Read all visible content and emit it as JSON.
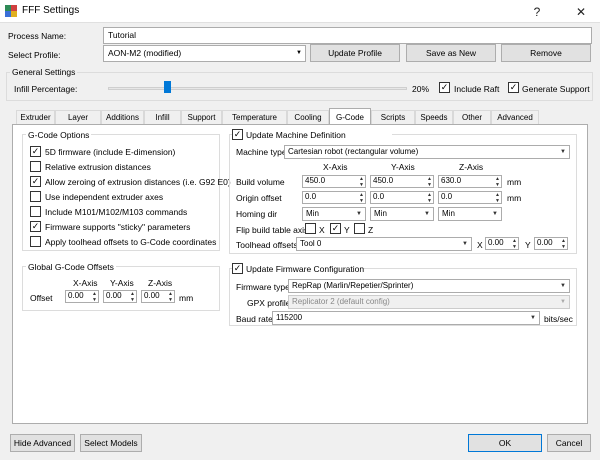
{
  "window": {
    "title": "FFF Settings",
    "help": "?",
    "close": "✕"
  },
  "process": {
    "label": "Process Name:",
    "value": "Tutorial"
  },
  "profile": {
    "label": "Select Profile:",
    "value": "AON-M2 (modified)",
    "update": "Update Profile",
    "save_as_new": "Save as New",
    "remove": "Remove"
  },
  "general": {
    "title": "General Settings",
    "infill_label": "Infill Percentage:",
    "infill_value": "20%",
    "infill_fraction": 0.2,
    "raft": "Include Raft",
    "support": "Generate Support"
  },
  "tabs": [
    "Extruder",
    "Layer",
    "Additions",
    "Infill",
    "Support",
    "Temperature",
    "Cooling",
    "G-Code",
    "Scripts",
    "Speeds",
    "Other",
    "Advanced"
  ],
  "gcode_options": {
    "title": "G-Code Options",
    "items": [
      {
        "label": "5D firmware (include E-dimension)",
        "checked": true
      },
      {
        "label": "Relative extrusion distances",
        "checked": false
      },
      {
        "label": "Allow zeroing of extrusion distances (i.e. G92 E0)",
        "checked": true
      },
      {
        "label": "Use independent extruder axes",
        "checked": false
      },
      {
        "label": "Include M101/M102/M103 commands",
        "checked": false
      },
      {
        "label": "Firmware supports \"sticky\" parameters",
        "checked": true
      },
      {
        "label": "Apply toolhead offsets to G-Code coordinates",
        "checked": false
      }
    ]
  },
  "offsets": {
    "title": "Global G-Code Offsets",
    "x_axis": "X-Axis",
    "y_axis": "Y-Axis",
    "z_axis": "Z-Axis",
    "label": "Offset",
    "x": "0.00",
    "y": "0.00",
    "z": "0.00",
    "unit": "mm"
  },
  "machine": {
    "title": "Update Machine Definition",
    "type_label": "Machine type",
    "type_value": "Cartesian robot (rectangular volume)",
    "x_axis": "X-Axis",
    "y_axis": "Y-Axis",
    "z_axis": "Z-Axis",
    "build_volume_label": "Build volume",
    "build_x": "450.0",
    "build_y": "450.0",
    "build_z": "630.0",
    "mm1": "mm",
    "origin_label": "Origin offset",
    "origin_x": "0.0",
    "origin_y": "0.0",
    "origin_z": "0.0",
    "mm2": "mm",
    "homing_label": "Homing dir",
    "home_x": "Min",
    "home_y": "Min",
    "home_z": "Min",
    "flip_label": "Flip build table axis",
    "flip_x": "X",
    "flip_y": "Y",
    "flip_z": "Z",
    "toolhead_label": "Toolhead offsets",
    "toolhead_value": "Tool 0",
    "th_x_label": "X",
    "th_x": "0.00",
    "th_y_label": "Y",
    "th_y": "0.00"
  },
  "firmware": {
    "title": "Update Firmware Configuration",
    "type_label": "Firmware type",
    "type_value": "RepRap (Marlin/Repetier/Sprinter)",
    "gpx_label": "GPX profile",
    "gpx_value": "Replicator 2 (default config)",
    "baud_label": "Baud rate",
    "baud_value": "115200",
    "baud_unit": "bits/sec"
  },
  "footer": {
    "hide_advanced": "Hide Advanced",
    "select_models": "Select Models",
    "ok": "OK",
    "cancel": "Cancel"
  },
  "colors": {
    "accent": "#0078d7"
  }
}
